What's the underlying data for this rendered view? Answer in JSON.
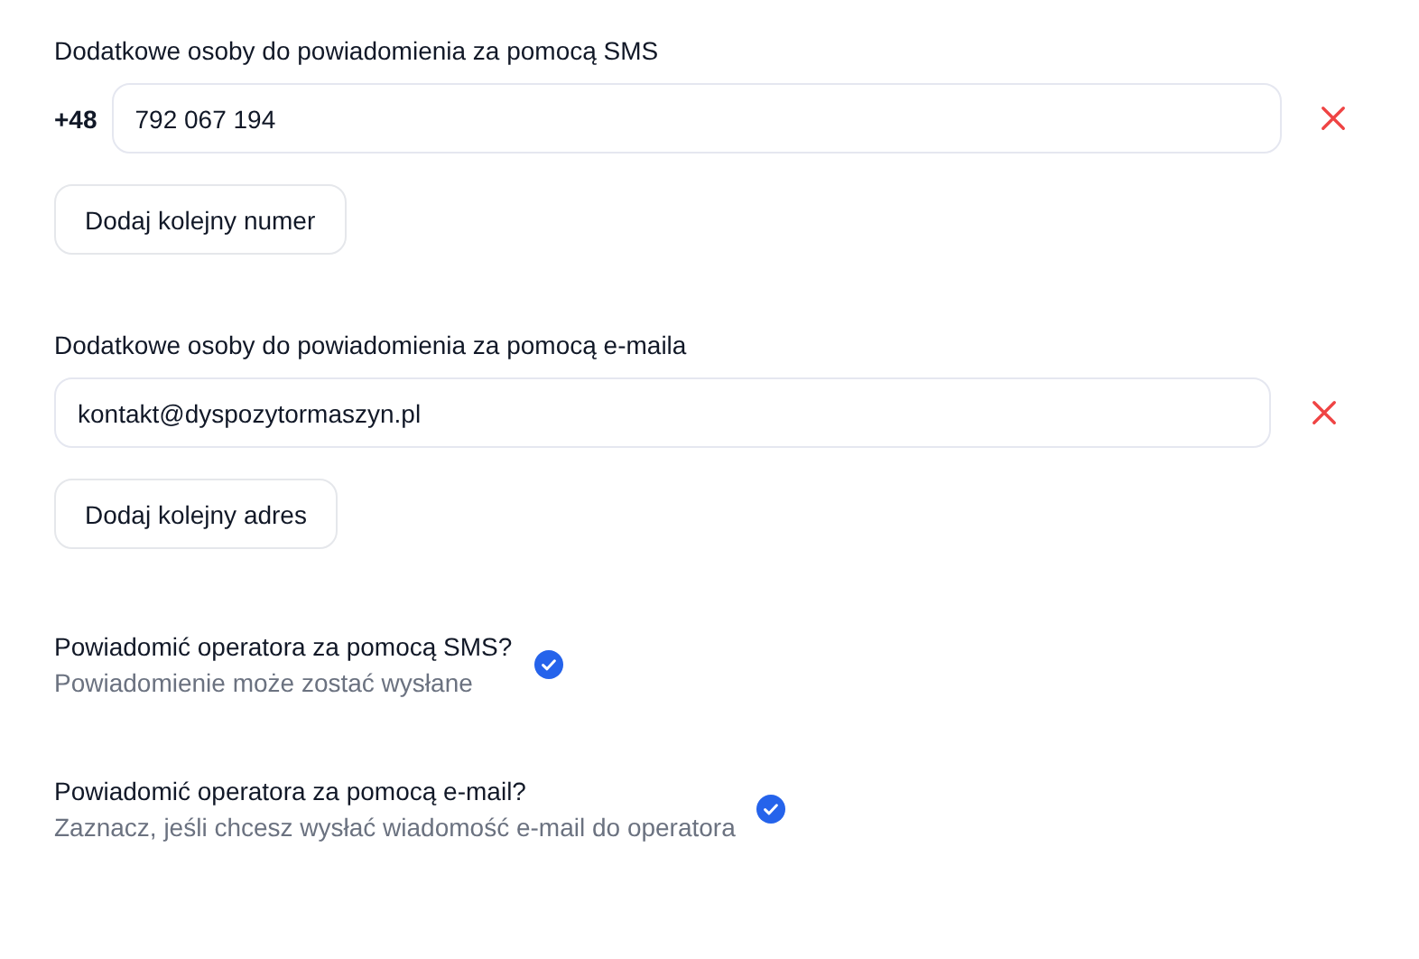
{
  "sms_section": {
    "heading": "Dodatkowe osoby do powiadomienia za pomocą SMS",
    "prefix": "+48",
    "entries": [
      {
        "value": "792 067 194"
      }
    ],
    "add_button": "Dodaj kolejny numer"
  },
  "email_section": {
    "heading": "Dodatkowe osoby do powiadomienia za pomocą e-maila",
    "entries": [
      {
        "value": "kontakt@dyspozytormaszyn.pl"
      }
    ],
    "add_button": "Dodaj kolejny adres"
  },
  "options": [
    {
      "title": "Powiadomić operatora za pomocą SMS?",
      "description": "Powiadomienie może zostać wysłane",
      "checked": true
    },
    {
      "title": "Powiadomić operatora za pomocą e-mail?",
      "description": "Zaznacz, jeśli chcesz wysłać wiadomość e-mail do operatora",
      "checked": true
    }
  ]
}
